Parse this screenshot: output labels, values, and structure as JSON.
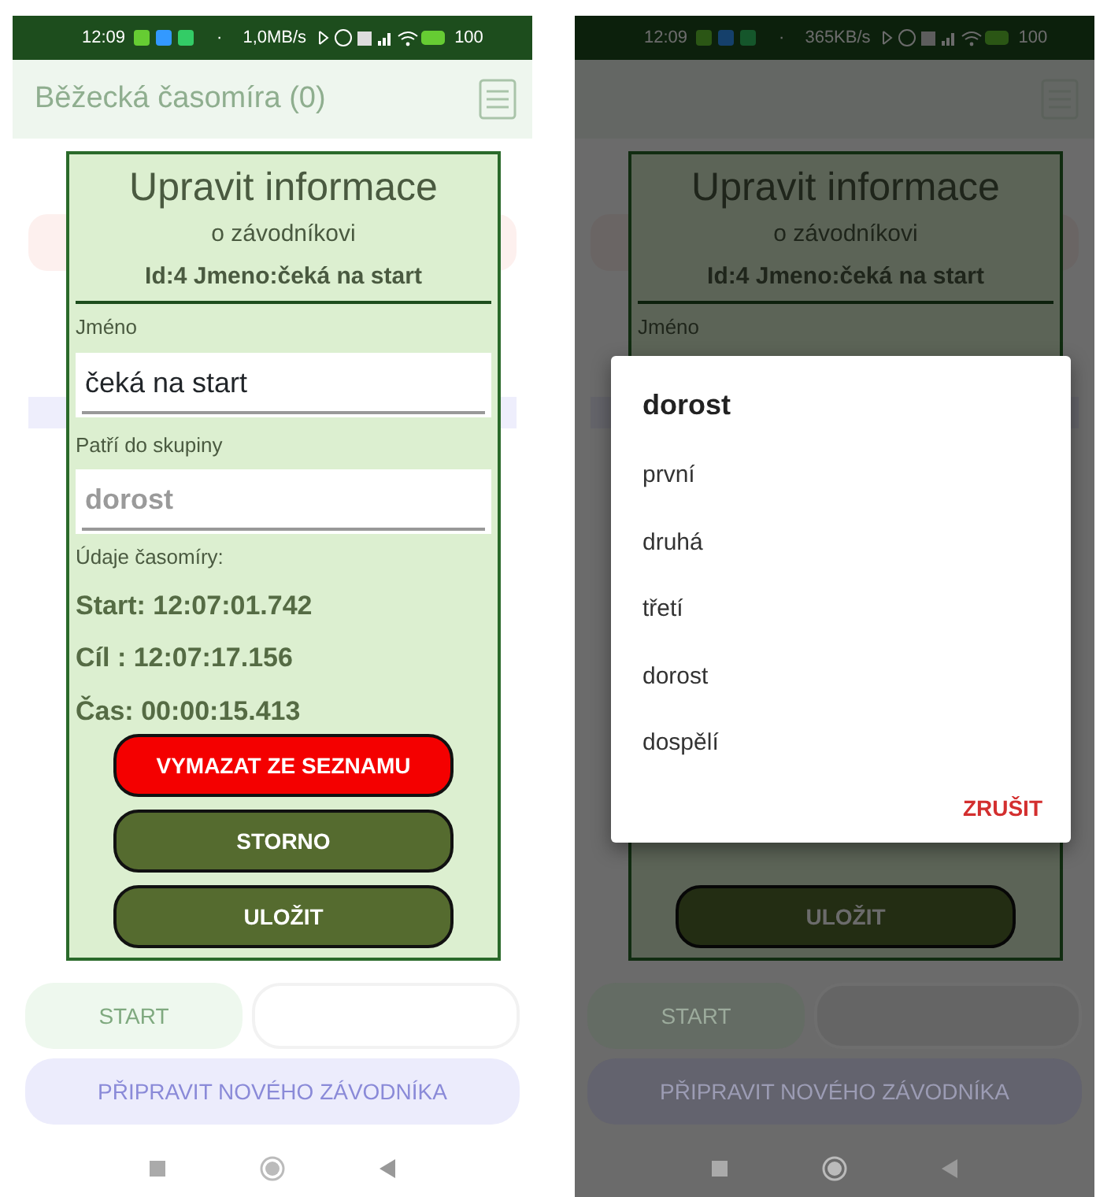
{
  "phones": [
    {
      "dimmed": false,
      "status_bar": {
        "time": "12:09",
        "separator": "·",
        "speed": "1,0MB/s",
        "battery": "100"
      },
      "app_title": "Běžecká časomíra (0)",
      "dialog": {
        "title": "Upravit informace",
        "subtitle": "o závodníkovi",
        "id_line": "Id:4 Jmeno:čeká na start",
        "name_label": "Jméno",
        "name_value": "čeká na start",
        "group_label": "Patří do skupiny",
        "group_value": "dorost",
        "timing_label": "Údaje časomíry:",
        "timing": [
          "Start: 12:07:01.742",
          "Cíl : 12:07:17.156",
          "Čas: 00:00:15.413"
        ],
        "buttons": [
          {
            "label": "VYMAZAT ZE SEZNAMU",
            "kind": "danger"
          },
          {
            "label": "STORNO",
            "kind": "primary"
          },
          {
            "label": "ULOŽIT",
            "kind": "primary"
          }
        ]
      },
      "bottom_buttons": [
        {
          "label": "START",
          "kind": "start"
        },
        {
          "kind": "blank"
        },
        {
          "label": "PŘIPRAVIT NOVÉHO ZÁVODNÍKA",
          "kind": "new"
        }
      ]
    },
    {
      "dimmed": true,
      "status_bar": {
        "time": "12:09",
        "separator": "·",
        "speed": "365KB/s",
        "battery": "100"
      },
      "dialog": {
        "title": "Upravit informace",
        "subtitle": "o závodníkovi",
        "id_line": "Id:4 Jmeno:čeká na start",
        "name_label": "Jméno",
        "buttons": [
          {
            "label": "ULOŽIT",
            "kind": "primary"
          }
        ]
      },
      "bottom_buttons": [
        {
          "label": "START",
          "kind": "start"
        },
        {
          "kind": "blank"
        },
        {
          "label": "PŘIPRAVIT NOVÉHO ZÁVODNÍKA",
          "kind": "new"
        }
      ],
      "picker": {
        "title": "dorost",
        "options": [
          "první",
          "druhá",
          "třetí",
          "dorost",
          "dospělí"
        ],
        "cancel": "ZRUŠIT"
      }
    }
  ]
}
